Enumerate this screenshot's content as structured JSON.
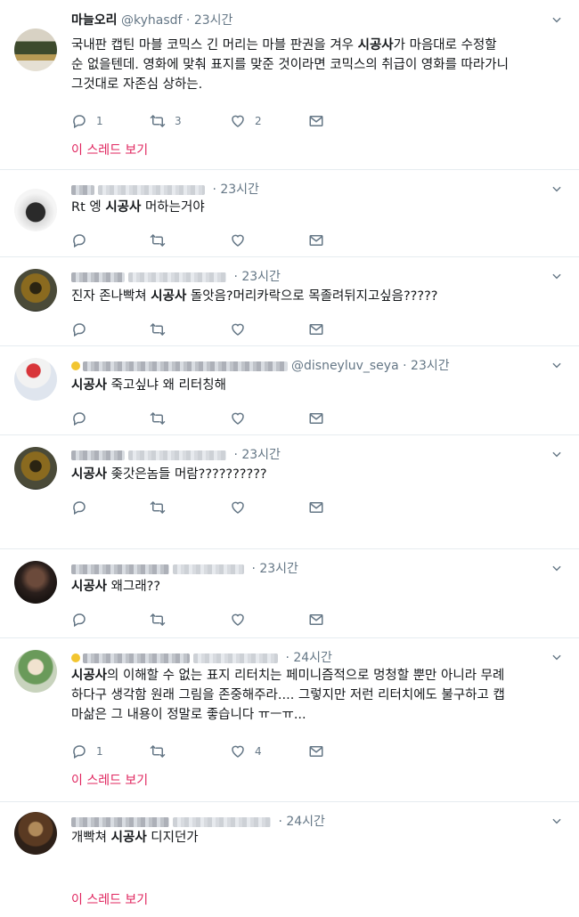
{
  "tweets": [
    {
      "name": "마늘오리",
      "handle": "@kyhasdf",
      "time": "23시간",
      "lines": [
        [
          "국내판 캡틴 마블 코믹스 긴 머리는 마블 판권을 겨우 ",
          {
            "b": "시공사"
          },
          "가 마음대로 수정할"
        ],
        [
          "순 없을텐데. 영화에 맞춰 표지를 맞준 것이라면 코믹스의 취급이 영화를 따라가니"
        ],
        [
          "그것대로 자존심 상하는."
        ]
      ],
      "reply": "1",
      "retweet": "3",
      "like": "2",
      "thread": "이 스레드 보기"
    },
    {
      "name": "",
      "handle": "",
      "time": "23시간",
      "lines": [
        [
          "Rt 엥 ",
          {
            "b": "시공사"
          },
          " 머하는거야"
        ]
      ],
      "reply": "",
      "retweet": "",
      "like": ""
    },
    {
      "name": "",
      "handle": "",
      "time": "23시간",
      "lines": [
        [
          "진자 존나빡쳐 ",
          {
            "b": "시공사"
          },
          " 돌앗음?머리카락으로 목졸려뒤지고싶음?????"
        ]
      ],
      "reply": "",
      "retweet": "",
      "like": ""
    },
    {
      "name": "",
      "handle": "@disneyluv_seya",
      "time": "23시간",
      "lines": [
        [
          {
            "b": "시공사"
          },
          " 죽고싶냐 왜 리터칭해"
        ]
      ],
      "reply": "",
      "retweet": "",
      "like": ""
    },
    {
      "name": "",
      "handle": "",
      "time": "23시간",
      "lines": [
        [
          {
            "b": "시공사"
          },
          " 좆갓은놈들 머람??????????"
        ]
      ],
      "reply": "",
      "retweet": "",
      "like": ""
    },
    {
      "name": "",
      "handle": "",
      "time": "23시간",
      "lines": [
        [
          {
            "b": "시공사"
          },
          " 왜그래??"
        ]
      ],
      "reply": "",
      "retweet": "",
      "like": ""
    },
    {
      "name": "",
      "handle": "",
      "time": "24시간",
      "lines": [
        [
          {
            "b": "시공사"
          },
          "의 이해할 수 없는 표지 리터치는 페미니즘적으로 멍청할 뿐만 아니라 무례"
        ],
        [
          "하다구 생각함 원래 그림을 존중해주라.... 그렇지만 저런 리터치에도 불구하고 캡"
        ],
        [
          "마삶은 그 내용이 정말로 좋습니다 ㅠㅡㅠ..."
        ]
      ],
      "reply": "1",
      "retweet": "",
      "like": "4",
      "thread": "이 스레드 보기"
    },
    {
      "name": "",
      "handle": "",
      "time": "24시간",
      "lines": [
        [
          "개빡쳐 ",
          {
            "b": "시공사"
          },
          " 디지던가"
        ]
      ],
      "reply": "",
      "retweet": "",
      "like": "",
      "thread": "이 스레드 보기"
    }
  ],
  "icons": {
    "reply": "reply-icon",
    "retweet": "retweet-icon",
    "like": "like-icon",
    "dm": "message-icon",
    "more": "chevron-down-icon"
  },
  "colors": {
    "thread_link": "#e0245e",
    "muted": "#657786",
    "divider": "#e6ecf0"
  }
}
